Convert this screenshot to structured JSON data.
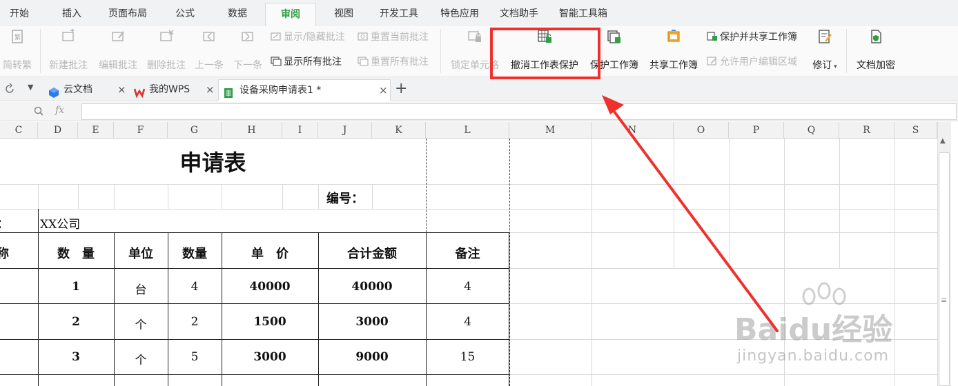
{
  "menu": {
    "tabs": [
      "开始",
      "插入",
      "页面布局",
      "公式",
      "数据",
      "审阅",
      "视图",
      "开发工具",
      "特色应用",
      "文档助手",
      "智能工具箱"
    ],
    "active": "审阅",
    "accent": "#2f9e44"
  },
  "ribbon": {
    "jian_zhuan_fan": "简转繁",
    "new_comment": "新建批注",
    "edit_comment": "编辑批注",
    "delete_comment": "删除批注",
    "prev": "上一条",
    "next": "下一条",
    "show_hide_comment": "显示/隐藏批注",
    "reset_current_comment": "重置当前批注",
    "show_all_comments": "显示所有批注",
    "reset_all_comments": "重置所有批注",
    "lock_cell": "锁定单元格",
    "unprotect_sheet": "撤消工作表保护",
    "protect_workbook": "保护工作簿",
    "share_workbook": "共享工作簿",
    "protect_and_share": "保护并共享工作簿",
    "allow_edit_ranges": "允许用户编辑区域",
    "track_changes": "修订",
    "encrypt": "文档加密"
  },
  "doc_tabs": {
    "cloud": "云文档",
    "mywps": "我的WPS",
    "file": "设备采购申请表1 *"
  },
  "formula_bar": {
    "fx": "fx"
  },
  "columns": [
    "C",
    "D",
    "E",
    "F",
    "G",
    "H",
    "I",
    "J",
    "K",
    "L",
    "M",
    "N",
    "O",
    "P",
    "Q",
    "R",
    "S"
  ],
  "sheet": {
    "title": "申请表",
    "number_label": "编号：",
    "company_prefix": "：",
    "company": "XX公司",
    "headers": {
      "partial": "称",
      "qty1": "数　量",
      "unit": "单位",
      "qty2": "数量",
      "price": "单　价",
      "total": "合计金额",
      "note": "备注"
    },
    "rows": [
      {
        "qty1": "1",
        "unit": "台",
        "qty2": "4",
        "price": "40000",
        "total": "40000",
        "note": "4"
      },
      {
        "qty1": "2",
        "unit": "个",
        "qty2": "2",
        "price": "1500",
        "total": "3000",
        "note": "4"
      },
      {
        "qty1": "3",
        "unit": "个",
        "qty2": "5",
        "price": "3000",
        "total": "9000",
        "note": "15"
      }
    ]
  },
  "watermark": {
    "brand": "Baidu经验",
    "url": "jingyan.baidu.com"
  },
  "colors": {
    "highlight": "#f0302c",
    "arrow": "#f0302c"
  }
}
